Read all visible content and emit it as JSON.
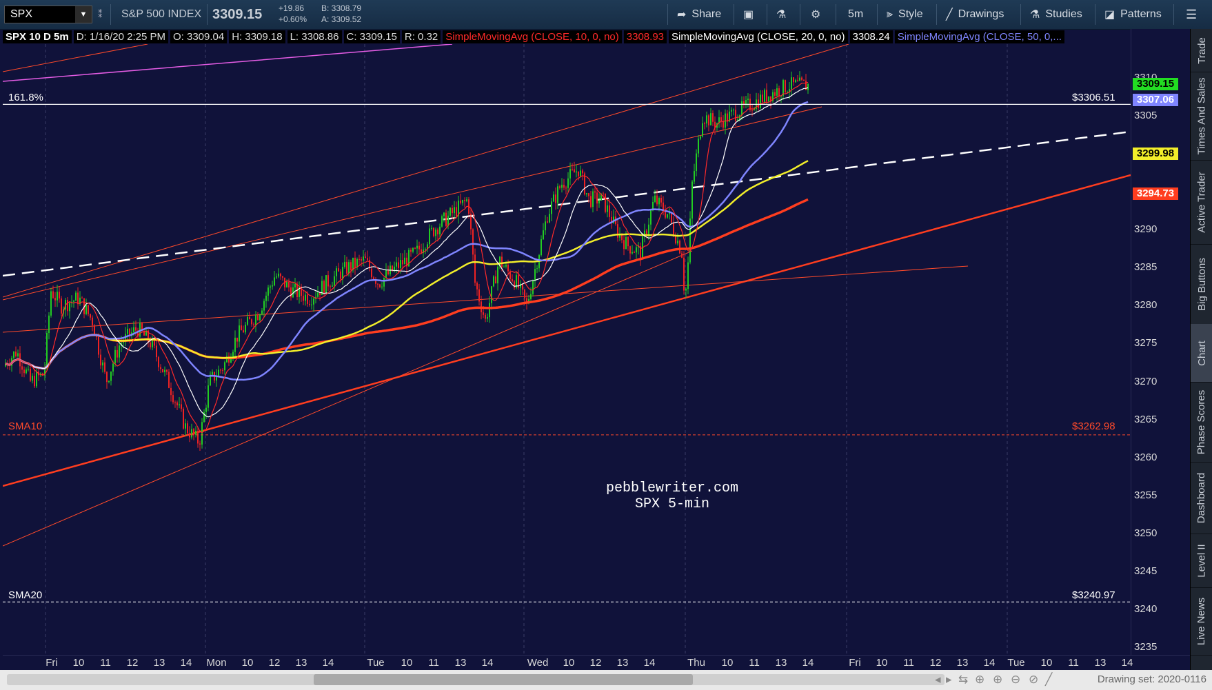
{
  "toolbar": {
    "symbol": "SPX",
    "instrument_name": "S&P 500 INDEX",
    "last_price": "3309.15",
    "change": "+19.86",
    "change_pct": "+0.60%",
    "bid": "B: 3308.79",
    "ask": "A: 3309.52",
    "share_label": "Share",
    "timeframe_label": "5m",
    "style_label": "Style",
    "drawings_label": "Drawings",
    "studies_label": "Studies",
    "patterns_label": "Patterns"
  },
  "legend": {
    "title": "SPX 10 D 5m",
    "date": "D: 1/16/20 2:25 PM",
    "open": "O: 3309.04",
    "high": "H: 3309.18",
    "low": "L: 3308.86",
    "close": "C: 3309.15",
    "range": "R: 0.32",
    "sma10_label": "SimpleMovingAvg (CLOSE, 10, 0, no)",
    "sma10_value": "3308.93",
    "sma20_label": "SimpleMovingAvg (CLOSE, 20, 0, no)",
    "sma20_value": "3308.24",
    "sma50_label": "SimpleMovingAvg (CLOSE, 50, 0,..."
  },
  "yaxis": {
    "ticks": [
      "3310",
      "3305",
      "3300",
      "3295",
      "3290",
      "3285",
      "3280",
      "3275",
      "3270",
      "3265",
      "3260",
      "3255",
      "3250",
      "3245",
      "3240",
      "3235"
    ],
    "price_tags": [
      {
        "text": "3309.15",
        "value": 3309.15,
        "color": "#22dd22"
      },
      {
        "text": "3307.06",
        "value": 3307.06,
        "color": "#7f85ff"
      },
      {
        "text": "3299.98",
        "value": 3299.98,
        "color": "#f2ee2a"
      },
      {
        "text": "3294.73",
        "value": 3294.73,
        "color": "#ff3d1f"
      }
    ]
  },
  "xaxis": {
    "ticks": [
      "Fri",
      "10",
      "11",
      "12",
      "13",
      "14",
      "Mon",
      "10",
      "12",
      "13",
      "14",
      "Tue",
      "10",
      "11",
      "13",
      "14",
      "Wed",
      "10",
      "12",
      "13",
      "14",
      "Thu",
      "10",
      "11",
      "13",
      "14",
      "Fri",
      "10",
      "11",
      "12",
      "13",
      "14",
      "Tue",
      "10",
      "11",
      "13",
      "14"
    ]
  },
  "levels": {
    "fib_label": "161.8%",
    "fib_price": "$3306.51",
    "fib_value": 3306.51,
    "sma10_label": "SMA10",
    "sma10_price": "$3262.98",
    "sma10_value": 3262.98,
    "sma20_label": "SMA20",
    "sma20_price": "$3240.97",
    "sma20_value": 3240.97
  },
  "watermark": {
    "line1": "pebblewriter.com",
    "line2": "SPX 5-min"
  },
  "sidebar": [
    "Trade",
    "Times And Sales",
    "Active Trader",
    "Big Buttons",
    "Chart",
    "Phase Scores",
    "Dashboard",
    "Level II",
    "Live News"
  ],
  "sidebar_active": "Chart",
  "bottombar": {
    "drawing_set": "Drawing set: 2020-0116"
  },
  "colors": {
    "background": "#10123a",
    "candle_up": "#22cc22",
    "candle_down": "#ee2222",
    "sma10": "#ff2a2a",
    "sma20": "#ffffff",
    "sma50": "#7f85ff",
    "sma100": "#f2ee2a",
    "sma200": "#ff3d1f"
  }
}
